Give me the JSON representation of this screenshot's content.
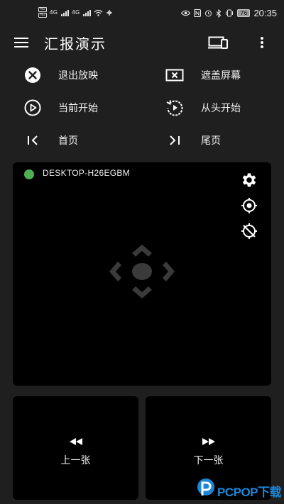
{
  "status_bar": {
    "sim_labels": [
      "HD",
      "HD"
    ],
    "network_labels": [
      "4G",
      "4G"
    ],
    "battery": "76",
    "time": "20:35"
  },
  "app_bar": {
    "title": "汇报演示"
  },
  "actions": {
    "exit_slideshow": "退出放映",
    "cover_screen": "遮盖屏幕",
    "start_from_current": "当前开始",
    "start_from_beginning": "从头开始",
    "first_page": "首页",
    "last_page": "尾页"
  },
  "remote_panel": {
    "device_name": "DESKTOP-H26EGBM",
    "status_color": "#4caf50"
  },
  "navigation": {
    "prev_label": "上一张",
    "next_label": "下一张"
  },
  "watermark": {
    "text": "PCPOP下载"
  },
  "colors": {
    "background": "#1f1f1f",
    "panel": "#000000",
    "accent_green": "#4caf50",
    "watermark_blue": "#1a87d8"
  }
}
